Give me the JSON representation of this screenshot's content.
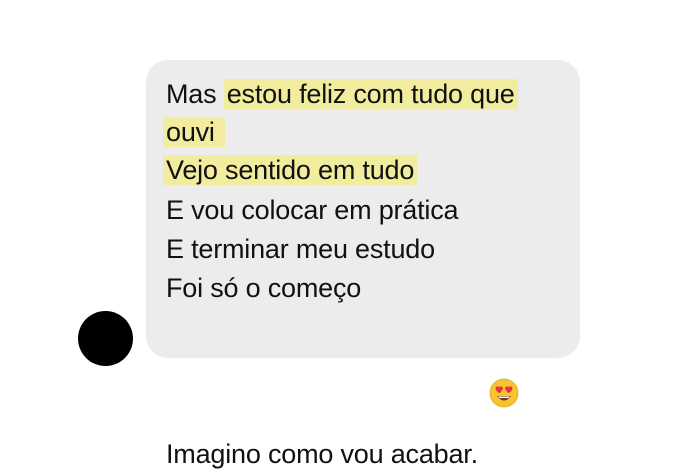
{
  "messages": {
    "line1": {
      "plain": "Mas ",
      "highlight": "estou feliz com tudo que"
    },
    "line2": {
      "highlight": "ouvi "
    },
    "line3": {
      "highlight": "Vejo sentido em tudo"
    },
    "line4": "E vou colocar em prática",
    "line5": "E terminar meu estudo",
    "line6": "Foi só o começo",
    "line7": "Imagino como vou acabar.",
    "emoji": "heart-eyes-emoji"
  },
  "colors": {
    "bubble": "#ececec",
    "highlight": "#f2ec9e",
    "text": "#111111",
    "avatar": "#000000"
  }
}
